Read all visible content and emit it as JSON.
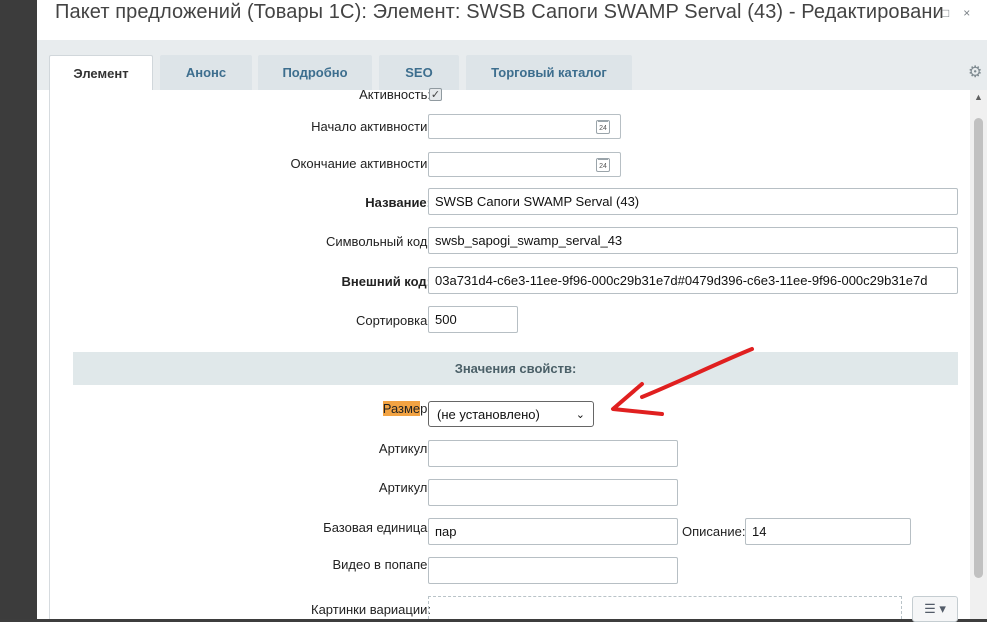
{
  "window": {
    "title": "Пакет предложений (Товары 1С): Элемент: SWSB Сапоги SWAMP Serval (43) - Редактировани",
    "restore_icon": "□",
    "close_icon": "×"
  },
  "tabs": [
    {
      "label": "Элемент",
      "active": true
    },
    {
      "label": "Анонс",
      "active": false
    },
    {
      "label": "Подробно",
      "active": false
    },
    {
      "label": "SEO",
      "active": false
    },
    {
      "label": "Торговый каталог",
      "active": false
    }
  ],
  "icons": {
    "settings": "gear-icon",
    "calendar": "calendar-icon",
    "select": "chevron-down-icon",
    "menu": "hamburger-menu-icon"
  },
  "form": {
    "active_label": "Активность:",
    "active_checked": true,
    "active_check_glyph": "✓",
    "start_label": "Начало активности:",
    "start_value": "",
    "end_label": "Окончание активности:",
    "end_value": "",
    "calendar_day": "24",
    "name_label": "Название:",
    "name_value": "SWSB Сапоги SWAMP Serval (43)",
    "code_label": "Символьный код:",
    "code_value": "swsb_sapogi_swamp_serval_43",
    "ext_label": "Внешний код:",
    "ext_value": "03a731d4-c6e3-11ee-9f96-000c29b31e7d#0479d396-c6e3-11ee-9f96-000c29b31e7d",
    "sort_label": "Сортировка:",
    "sort_value": "500"
  },
  "properties": {
    "section_title": "Значения свойств:",
    "size_label_hl": "Разме",
    "size_label_rest": "р:",
    "size_value": "(не установлено)",
    "size_chevron": "⌄",
    "article1_label": "Артикул:",
    "article1_value": "",
    "article2_label": "Артикул:",
    "article2_value": "",
    "unit_label": "Базовая единица:",
    "unit_value": "пар",
    "desc_label": "Описание:",
    "desc_value": "14",
    "video_label": "Видео в попапе:",
    "video_value": "",
    "images_label": "Картинки вариации:",
    "menu_glyph": "☰ ▾"
  },
  "scrollbar": {
    "up_arrow": "▲"
  },
  "colors": {
    "highlight": "#f2a343",
    "annotation_arrow": "#e02020",
    "tab_text": "#3d6e8e"
  }
}
